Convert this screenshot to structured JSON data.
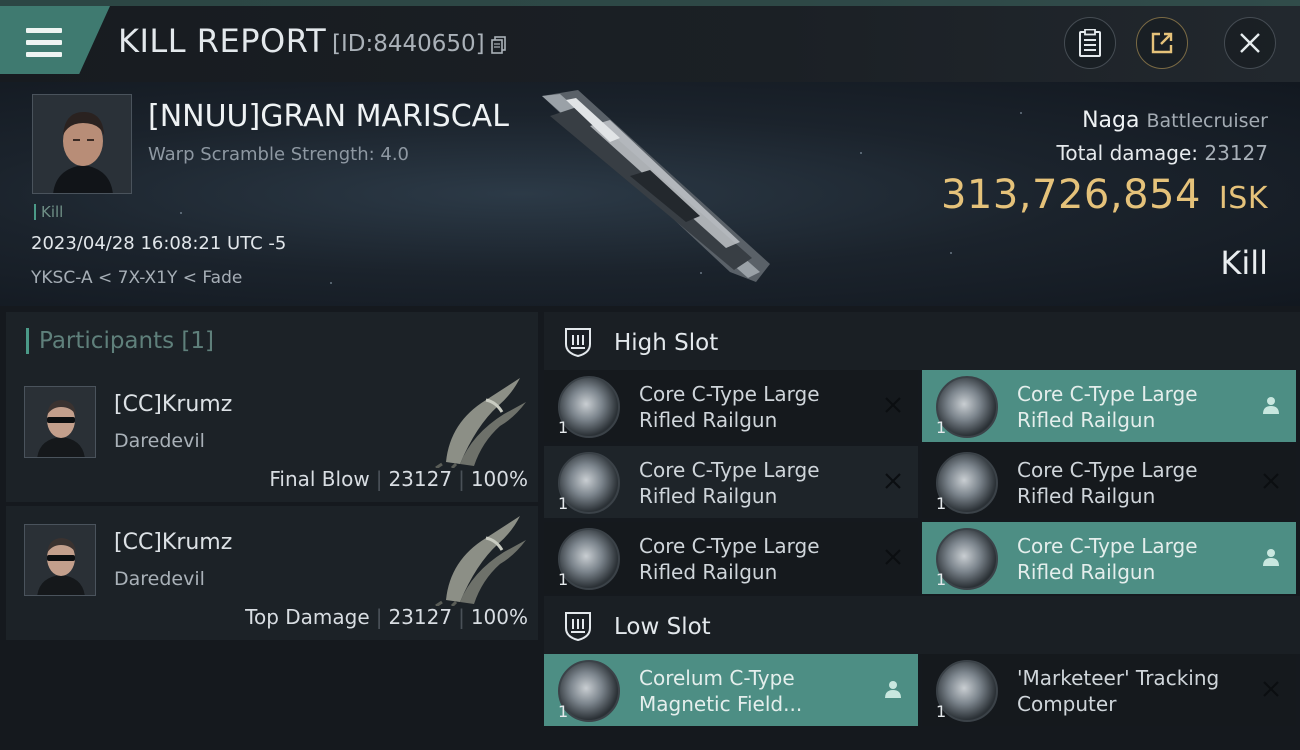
{
  "header": {
    "title": "KILL REPORT",
    "report_id": "[ID:8440650]"
  },
  "victim": {
    "name": "[NNUU]GRAN MARISCAL",
    "warp_scramble": "Warp Scramble Strength: 4.0",
    "kill_tag": "Kill",
    "datetime": "2023/04/28 16:08:21 UTC -5",
    "location": "YKSC-A < 7X-X1Y < Fade",
    "ship_name": "Naga",
    "ship_class": "Battlecruiser",
    "total_damage_label": "Total damage:",
    "total_damage": "23127",
    "isk_value": "313,726,854",
    "isk_unit": "ISK",
    "result": "Kill"
  },
  "participants": {
    "label": "Participants",
    "count": "[1]",
    "rows": [
      {
        "name": "[CC]Krumz",
        "ship": "Daredevil",
        "role": "Final Blow",
        "damage": "23127",
        "percent": "100%"
      },
      {
        "name": "[CC]Krumz",
        "ship": "Daredevil",
        "role": "Top Damage",
        "damage": "23127",
        "percent": "100%"
      }
    ]
  },
  "fitting": {
    "high_slot_label": "High Slot",
    "low_slot_label": "Low Slot",
    "high_modules": [
      {
        "line1": "Core C-Type Large",
        "line2": "Rifled Railgun",
        "qty": "1",
        "status": "destroyed"
      },
      {
        "line1": "Core C-Type Large",
        "line2": "Rifled Railgun",
        "qty": "1",
        "status": "dropped"
      },
      {
        "line1": "Core C-Type Large",
        "line2": "Rifled Railgun",
        "qty": "1",
        "status": "destroyed"
      },
      {
        "line1": "Core C-Type Large",
        "line2": "Rifled Railgun",
        "qty": "1",
        "status": "destroyed"
      },
      {
        "line1": "Core C-Type Large",
        "line2": "Rifled Railgun",
        "qty": "1",
        "status": "destroyed"
      },
      {
        "line1": "Core C-Type Large",
        "line2": "Rifled Railgun",
        "qty": "1",
        "status": "dropped"
      }
    ],
    "low_modules": [
      {
        "line1": "Corelum C-Type",
        "line2": "Magnetic Field...",
        "qty": "1",
        "status": "dropped"
      },
      {
        "line1": "'Marketeer' Tracking",
        "line2": "Computer",
        "qty": "1",
        "status": "destroyed"
      }
    ]
  },
  "icons": {
    "menu": "hamburger-menu-icon",
    "copy": "copy-icon",
    "clipboard": "clipboard-icon",
    "share": "share-icon",
    "close": "close-icon",
    "destroyed": "x-mark-icon",
    "dropped": "person-icon",
    "high_slot": "high-slot-icon",
    "low_slot": "low-slot-icon"
  },
  "colors": {
    "accent": "#4d8e84",
    "isk": "#e5c27a",
    "background": "#15191e"
  }
}
